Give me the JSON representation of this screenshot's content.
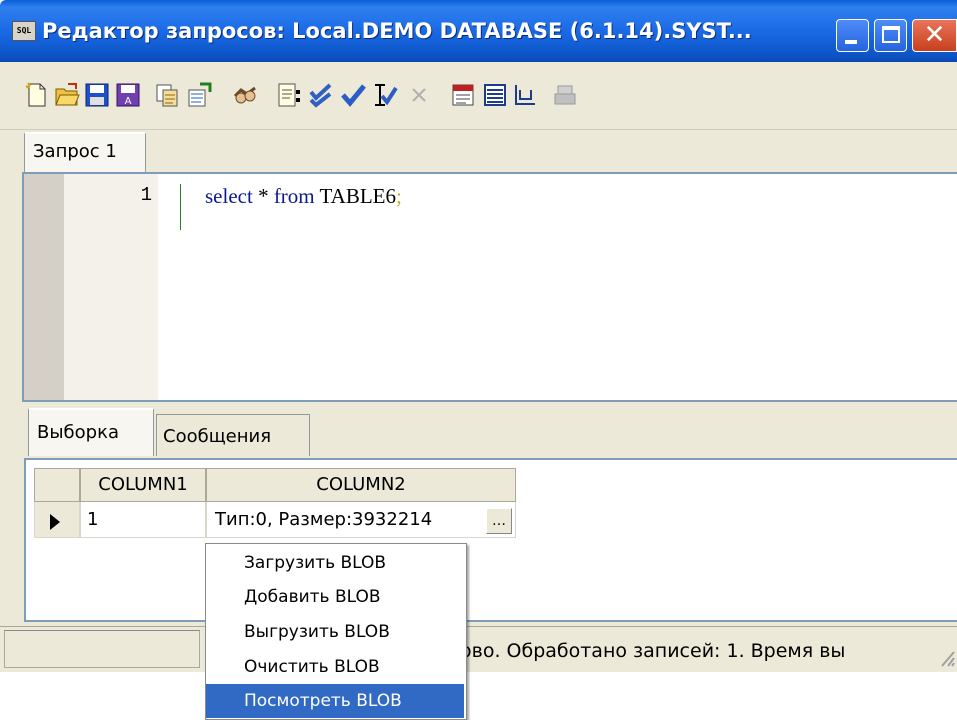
{
  "window": {
    "title": "Редактор запросов: Local.DEMO DATABASE (6.1.14).SYST...",
    "icon_text": "SQL"
  },
  "toolbar": {
    "buttons": [
      "new-query-icon",
      "open-file-icon",
      "save-icon",
      "save-as-icon",
      "copy-results-icon",
      "export-icon",
      "connect-icon",
      "format-sql-icon",
      "check-syntax-icon",
      "commit-icon",
      "commit-all-icon",
      "cancel-icon",
      "run-script-icon",
      "grid-view-icon",
      "plan-icon",
      "print-icon"
    ]
  },
  "editor": {
    "tab_label": "Запрос 1",
    "line_number": "1",
    "code": {
      "kw1": "select",
      "rest1": " * ",
      "kw2": "from",
      "table": " TABLE6",
      "semicolon": ";"
    }
  },
  "results": {
    "tabs": [
      "Выборка",
      "Сообщения"
    ],
    "columns": [
      "COLUMN1",
      "COLUMN2"
    ],
    "rows": [
      {
        "col1": "1",
        "col2": "Тип:0, Размер:3932214"
      }
    ],
    "blob_button_glyph": "…"
  },
  "context_menu": {
    "items": [
      "Загрузить BLOB",
      "Добавить BLOB",
      "Выгрузить BLOB",
      "Очистить BLOB",
      "Посмотреть BLOB"
    ],
    "selected_index": 4
  },
  "statusbar": {
    "text": "ово. Обработано записей: 1. Время вы"
  },
  "colors": {
    "titlebar": "#0a5fd8",
    "menu_highlight": "#316ac5",
    "window_bg": "#ece9d8"
  }
}
